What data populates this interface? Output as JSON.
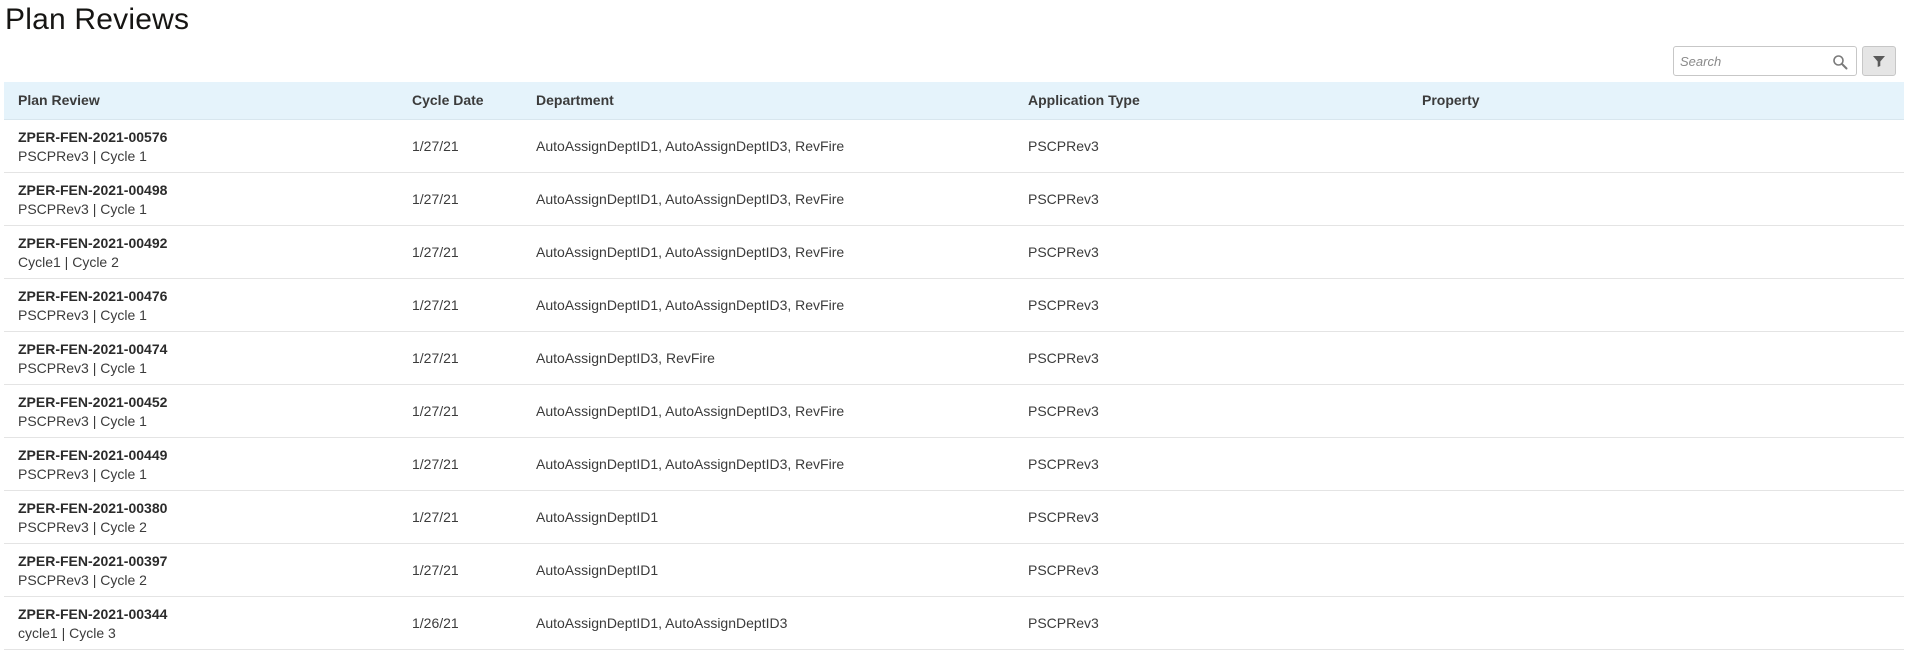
{
  "page": {
    "title": "Plan Reviews"
  },
  "search": {
    "placeholder": "Search",
    "icon": "search-icon"
  },
  "filter": {
    "icon": "filter-icon"
  },
  "table": {
    "columns": [
      "Plan Review",
      "Cycle Date",
      "Department",
      "Application Type",
      "Property"
    ],
    "rows": [
      {
        "id": "ZPER-FEN-2021-00576",
        "sub": "PSCPRev3 | Cycle 1",
        "cycle_date": "1/27/21",
        "department": "AutoAssignDeptID1, AutoAssignDeptID3, RevFire",
        "application_type": "PSCPRev3",
        "property": ""
      },
      {
        "id": "ZPER-FEN-2021-00498",
        "sub": "PSCPRev3 | Cycle 1",
        "cycle_date": "1/27/21",
        "department": "AutoAssignDeptID1, AutoAssignDeptID3, RevFire",
        "application_type": "PSCPRev3",
        "property": ""
      },
      {
        "id": "ZPER-FEN-2021-00492",
        "sub": "Cycle1 | Cycle 2",
        "cycle_date": "1/27/21",
        "department": "AutoAssignDeptID1, AutoAssignDeptID3, RevFire",
        "application_type": "PSCPRev3",
        "property": ""
      },
      {
        "id": "ZPER-FEN-2021-00476",
        "sub": "PSCPRev3 | Cycle 1",
        "cycle_date": "1/27/21",
        "department": "AutoAssignDeptID1, AutoAssignDeptID3, RevFire",
        "application_type": "PSCPRev3",
        "property": ""
      },
      {
        "id": "ZPER-FEN-2021-00474",
        "sub": "PSCPRev3 | Cycle 1",
        "cycle_date": "1/27/21",
        "department": "AutoAssignDeptID3, RevFire",
        "application_type": "PSCPRev3",
        "property": ""
      },
      {
        "id": "ZPER-FEN-2021-00452",
        "sub": "PSCPRev3 | Cycle 1",
        "cycle_date": "1/27/21",
        "department": "AutoAssignDeptID1, AutoAssignDeptID3, RevFire",
        "application_type": "PSCPRev3",
        "property": ""
      },
      {
        "id": "ZPER-FEN-2021-00449",
        "sub": "PSCPRev3 | Cycle 1",
        "cycle_date": "1/27/21",
        "department": "AutoAssignDeptID1, AutoAssignDeptID3, RevFire",
        "application_type": "PSCPRev3",
        "property": ""
      },
      {
        "id": "ZPER-FEN-2021-00380",
        "sub": "PSCPRev3 | Cycle 2",
        "cycle_date": "1/27/21",
        "department": "AutoAssignDeptID1",
        "application_type": "PSCPRev3",
        "property": ""
      },
      {
        "id": "ZPER-FEN-2021-00397",
        "sub": "PSCPRev3 | Cycle 2",
        "cycle_date": "1/27/21",
        "department": "AutoAssignDeptID1",
        "application_type": "PSCPRev3",
        "property": ""
      },
      {
        "id": "ZPER-FEN-2021-00344",
        "sub": "cycle1 | Cycle 3",
        "cycle_date": "1/26/21",
        "department": "AutoAssignDeptID1, AutoAssignDeptID3",
        "application_type": "PSCPRev3",
        "property": ""
      }
    ]
  },
  "colors": {
    "header_background": "#e5f3fb",
    "row_divider": "#e4e4e4",
    "text": "#3b3b3b"
  }
}
